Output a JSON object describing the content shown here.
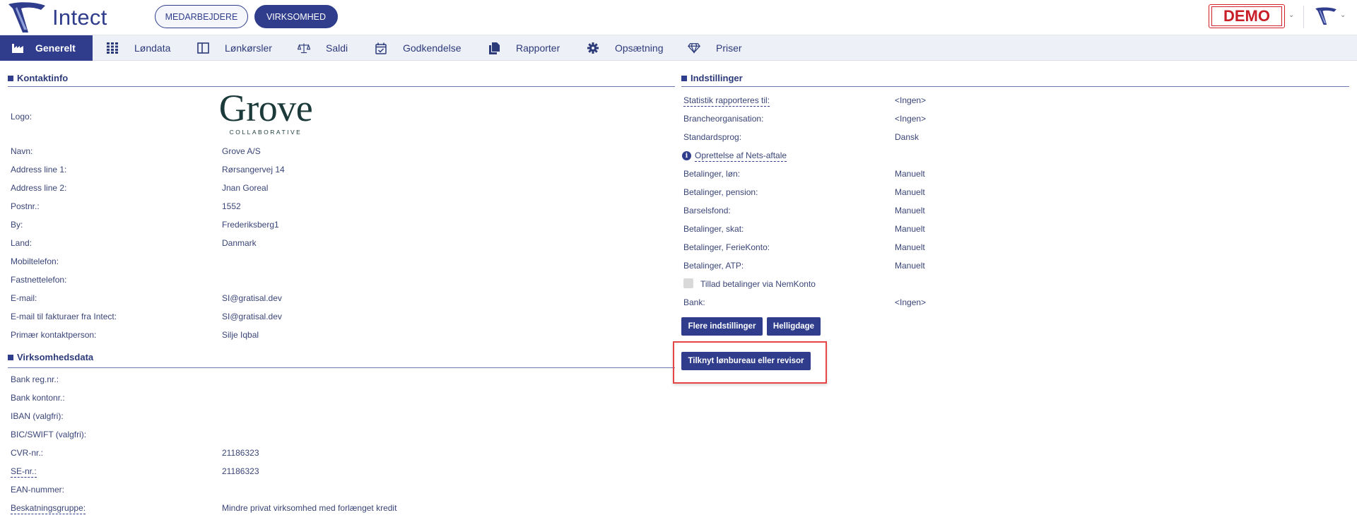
{
  "header": {
    "logo_text": "Intect",
    "btn_employees": "MEDARBEJDERE",
    "btn_company": "VIRKSOMHED",
    "demo_label": "DEMO"
  },
  "nav": {
    "items": [
      {
        "label": "Generelt",
        "icon": "factory-icon",
        "active": true
      },
      {
        "label": "Løndata",
        "icon": "grid-icon"
      },
      {
        "label": "Lønkørsler",
        "icon": "columns-icon"
      },
      {
        "label": "Saldi",
        "icon": "scale-icon"
      },
      {
        "label": "Godkendelse",
        "icon": "calendar-check-icon"
      },
      {
        "label": "Rapporter",
        "icon": "documents-icon"
      },
      {
        "label": "Opsætning",
        "icon": "gear-icon"
      },
      {
        "label": "Priser",
        "icon": "diamond-icon"
      }
    ]
  },
  "contact": {
    "title": "Kontaktinfo",
    "logo_label": "Logo:",
    "company_logo_main": "Grove",
    "company_logo_sub": "COLLABORATIVE",
    "rows": [
      {
        "label": "Navn:",
        "value": "Grove A/S"
      },
      {
        "label": "Address line 1:",
        "value": "Rørsangervej 14"
      },
      {
        "label": "Address line 2:",
        "value": "Jnan Goreal"
      },
      {
        "label": "Postnr.:",
        "value": "1552"
      },
      {
        "label": "By:",
        "value": "Frederiksberg1"
      },
      {
        "label": "Land:",
        "value": "Danmark"
      },
      {
        "label": "Mobiltelefon:",
        "value": ""
      },
      {
        "label": "Fastnettelefon:",
        "value": ""
      },
      {
        "label": "E-mail:",
        "value": "SI@gratisal.dev"
      },
      {
        "label": "E-mail til fakturaer fra Intect:",
        "value": "SI@gratisal.dev"
      },
      {
        "label": "Primær kontaktperson:",
        "value": "Silje Iqbal"
      }
    ]
  },
  "company": {
    "title": "Virksomhedsdata",
    "rows": [
      {
        "label": "Bank reg.nr.:",
        "value": ""
      },
      {
        "label": "Bank kontonr.:",
        "value": ""
      },
      {
        "label": "IBAN (valgfri):",
        "value": ""
      },
      {
        "label": "BIC/SWIFT (valgfri):",
        "value": ""
      },
      {
        "label": "CVR-nr.:",
        "value": "21186323"
      },
      {
        "label": "SE-nr.:",
        "value": "21186323"
      },
      {
        "label": "EAN-nummer:",
        "value": ""
      },
      {
        "label": "Beskatningsgruppe:",
        "value": "Mindre privat virksomhed med forlænget kredit"
      }
    ]
  },
  "settings": {
    "title": "Indstillinger",
    "rows": [
      {
        "label": "Statistik rapporteres til:",
        "value": "<Ingen>"
      },
      {
        "label": "Brancheorganisation:",
        "value": "<Ingen>"
      },
      {
        "label": "Standardsprog:",
        "value": "Dansk"
      },
      {
        "label": "Oprettelse af Nets-aftale",
        "value": ""
      },
      {
        "label": "Betalinger, løn:",
        "value": "Manuelt"
      },
      {
        "label": "Betalinger, pension:",
        "value": "Manuelt"
      },
      {
        "label": "Barselsfond:",
        "value": "Manuelt"
      },
      {
        "label": "Betalinger, skat:",
        "value": "Manuelt"
      },
      {
        "label": "Betalinger, FerieKonto:",
        "value": "Manuelt"
      },
      {
        "label": "Betalinger, ATP:",
        "value": "Manuelt"
      },
      {
        "label": "Tillad betalinger via NemKonto",
        "value": ""
      },
      {
        "label": "Bank:",
        "value": "<Ingen>"
      }
    ],
    "btn_more": "Flere indstillinger",
    "btn_holidays": "Helligdage",
    "btn_attach": "Tilknyt lønbureau eller revisor"
  }
}
